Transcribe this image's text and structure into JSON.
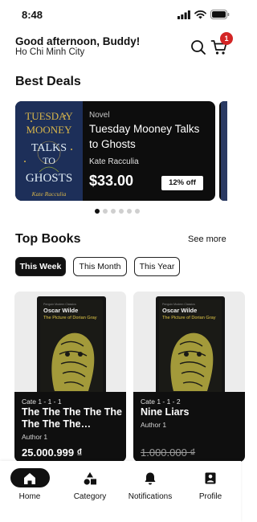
{
  "status_bar": {
    "time": "8:48"
  },
  "header": {
    "greeting": "Good afternoon, Buddy!",
    "location": "Ho Chi Minh City",
    "cart_count": "1"
  },
  "best_deals": {
    "title": "Best Deals",
    "deal": {
      "genre": "Novel",
      "title": "Tuesday Mooney Talks to Ghosts",
      "author": "Kate Racculia",
      "price": "$33.00",
      "discount": "12% off",
      "cover_text": [
        "TUESDAY",
        "MOONEY",
        "TALKS",
        "TO",
        "GHOSTS",
        "Kate Racculia"
      ]
    },
    "pagination": {
      "count": 6,
      "active": 1
    }
  },
  "top_books": {
    "title": "Top Books",
    "see_more": "See more",
    "tabs": [
      {
        "label": "This Week",
        "active": true
      },
      {
        "label": "This Month",
        "active": false
      },
      {
        "label": "This Year",
        "active": false
      }
    ],
    "books": [
      {
        "category": "Cate 1 - 1 - 1",
        "title": "The The The The The The The The…",
        "author": "Author 1",
        "price": "25.000.999 ₫",
        "strikethrough": false,
        "cover_author": "Oscar Wilde",
        "cover_title": "The Picture of Dorian Gray",
        "cover_publisher": "Penguin Modern Classics"
      },
      {
        "category": "Cate 1 - 1 - 2",
        "title": "Nine Liars",
        "author": "Author 1",
        "price": "1.000.000 ₫",
        "strikethrough": true,
        "cover_author": "Oscar Wilde",
        "cover_title": "The Picture of Dorian Gray",
        "cover_publisher": "Penguin Modern Classics"
      }
    ]
  },
  "bottom_nav": {
    "items": [
      {
        "label": "Home",
        "icon": "home-icon",
        "active": true
      },
      {
        "label": "Category",
        "icon": "category-icon",
        "active": false
      },
      {
        "label": "Notifications",
        "icon": "bell-icon",
        "active": false
      },
      {
        "label": "Profile",
        "icon": "profile-icon",
        "active": false
      }
    ]
  },
  "colors": {
    "primary": "#111111",
    "badge": "#d32525",
    "cover_blue": "#1d2f59",
    "cover_gold": "#d8b54a",
    "cover_green": "#8fa33a"
  }
}
